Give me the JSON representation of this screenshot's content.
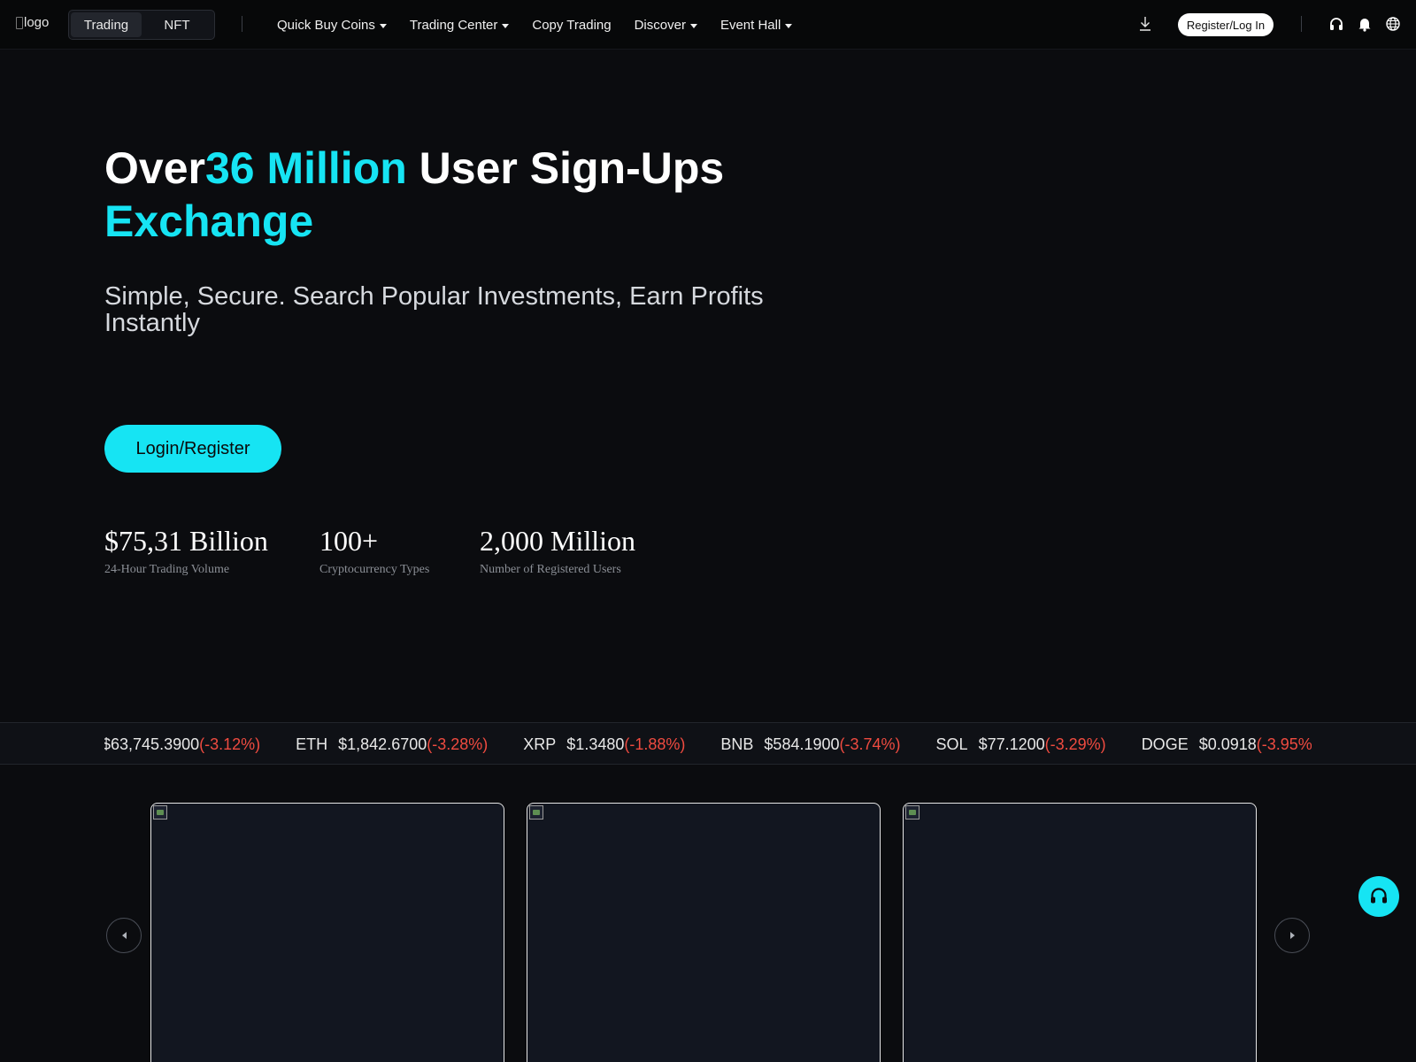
{
  "header": {
    "logo_alt": "logo",
    "modes": [
      "Trading",
      "NFT"
    ],
    "nav": [
      {
        "label": "Quick Buy Coins",
        "dropdown": true
      },
      {
        "label": "Trading Center",
        "dropdown": true
      },
      {
        "label": "Copy Trading",
        "dropdown": false
      },
      {
        "label": "Discover",
        "dropdown": true
      },
      {
        "label": "Event Hall",
        "dropdown": true
      }
    ],
    "register_label": "Register/Log In",
    "icons": [
      "download-icon",
      "headset-icon",
      "bell-icon",
      "globe-icon"
    ]
  },
  "hero": {
    "title_prefix": "Over",
    "title_highlight": "36 Million",
    "title_rest": " User Sign-Ups",
    "title_line2": "Exchange",
    "subtitle": "Simple, Secure. Search Popular Investments, Earn Profits Instantly",
    "cta_label": "Login/Register"
  },
  "stats": [
    {
      "value": "$75,31 Billion",
      "label": "24-Hour Trading Volume"
    },
    {
      "value": "100+",
      "label": "Cryptocurrency Types"
    },
    {
      "value": "2,000 Million",
      "label": "Number of Registered Users"
    }
  ],
  "ticker": [
    {
      "symbol": "",
      "price": "$63,745.3900",
      "change": "(-3.12%)"
    },
    {
      "symbol": "ETH",
      "price": "$1,842.6700",
      "change": "(-3.28%)"
    },
    {
      "symbol": "XRP",
      "price": "$1.3480",
      "change": "(-1.88%)"
    },
    {
      "symbol": "BNB",
      "price": "$584.1900",
      "change": "(-3.74%)"
    },
    {
      "symbol": "SOL",
      "price": "$77.1200",
      "change": "(-3.29%)"
    },
    {
      "symbol": "DOGE",
      "price": "$0.0918",
      "change": "(-3.95%)"
    }
  ],
  "colors": {
    "accent": "#16e4f3",
    "negative": "#ef4b40",
    "background": "#0b0c0f"
  }
}
